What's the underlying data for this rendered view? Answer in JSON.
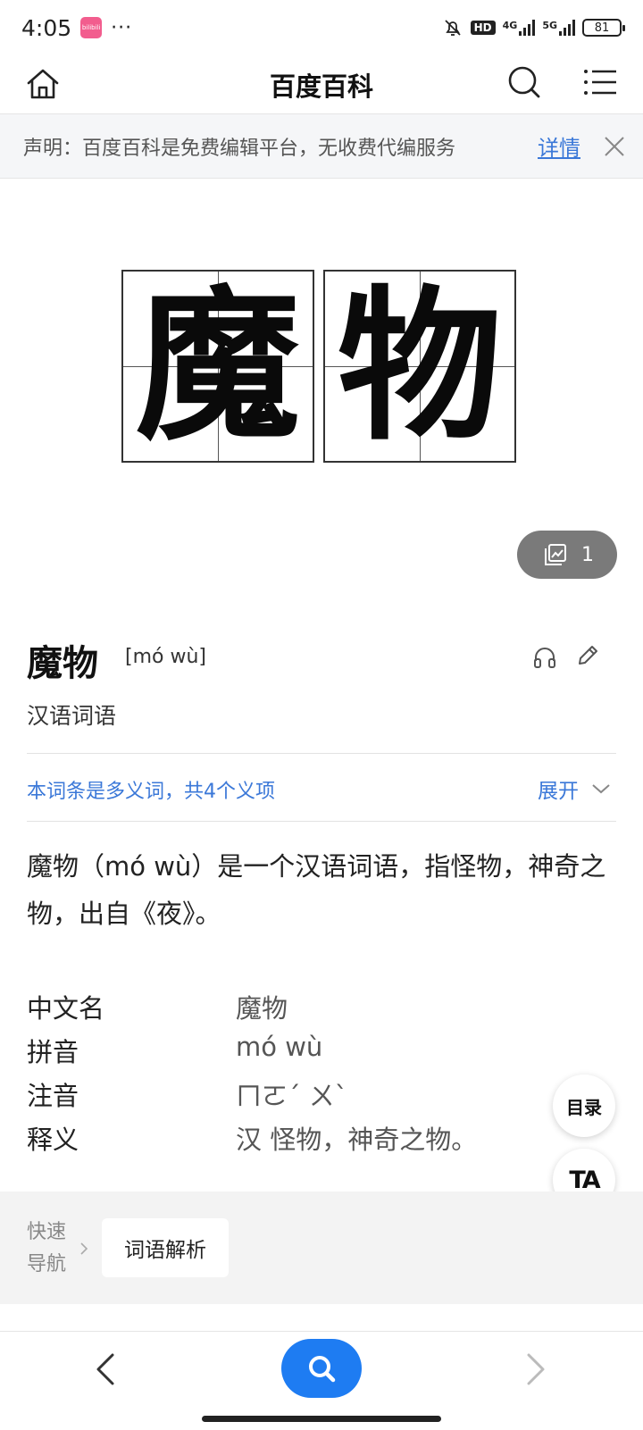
{
  "status_bar": {
    "time": "4:05",
    "app_icon_text": "bilibili",
    "dots": "···",
    "hd_label": "HD",
    "net1_label": "4G",
    "net2_label": "5G",
    "battery": "81"
  },
  "nav": {
    "title": "百度百科"
  },
  "notice": {
    "text": "声明：百度百科是免费编辑平台，无收费代编服务",
    "link": "详情"
  },
  "hero": {
    "char1": "魔",
    "char2": "物",
    "album_count": "1"
  },
  "entry": {
    "title": "魔物",
    "pinyin": "[mó wù]",
    "category": "汉语词语",
    "polysemy_notice": "本词条是多义词，共4个义项",
    "expand_label": "展开",
    "summary": "魔物（mó wù）是一个汉语词语，指怪物，神奇之物，出自《夜》。"
  },
  "info_box": [
    {
      "key": "中文名",
      "value": "魔物"
    },
    {
      "key": "拼音",
      "value": "mó wù"
    },
    {
      "key": "注音",
      "value": "ㄇㄛˊ ㄨˋ"
    },
    {
      "key": "释义",
      "value": "汉 怪物，神奇之物。"
    }
  ],
  "floating": {
    "toc_label": "目录",
    "ta_label": "TA"
  },
  "quick_nav": {
    "label": "快速导航",
    "chip": "词语解析"
  },
  "colors": {
    "link_blue": "#3b78d8",
    "search_blue": "#1e7cf2"
  }
}
